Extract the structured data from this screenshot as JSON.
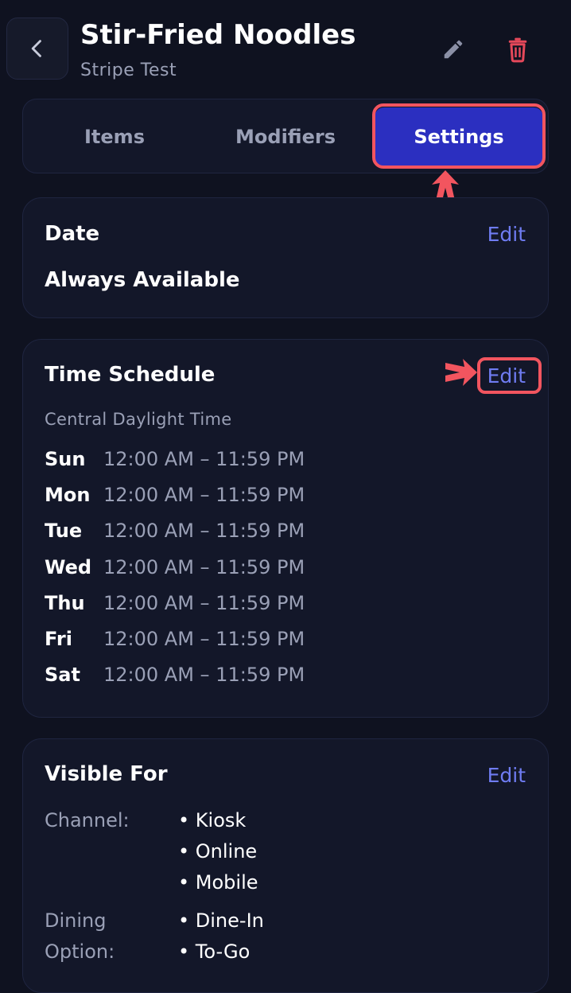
{
  "header": {
    "title": "Stir-Fried Noodles",
    "subtitle": "Stripe Test"
  },
  "tabs": [
    {
      "label": "Items",
      "active": false
    },
    {
      "label": "Modifiers",
      "active": false
    },
    {
      "label": "Settings",
      "active": true
    }
  ],
  "date_card": {
    "title": "Date",
    "edit_label": "Edit",
    "value": "Always Available"
  },
  "time_card": {
    "title": "Time Schedule",
    "edit_label": "Edit",
    "timezone": "Central Daylight Time",
    "schedule": [
      {
        "day": "Sun",
        "hours": "12:00 AM – 11:59 PM"
      },
      {
        "day": "Mon",
        "hours": "12:00 AM – 11:59 PM"
      },
      {
        "day": "Tue",
        "hours": "12:00 AM – 11:59 PM"
      },
      {
        "day": "Wed",
        "hours": "12:00 AM – 11:59 PM"
      },
      {
        "day": "Thu",
        "hours": "12:00 AM – 11:59 PM"
      },
      {
        "day": "Fri",
        "hours": "12:00 AM – 11:59 PM"
      },
      {
        "day": "Sat",
        "hours": "12:00 AM – 11:59 PM"
      }
    ]
  },
  "visible_card": {
    "title": "Visible For",
    "edit_label": "Edit",
    "channel_label": "Channel:",
    "channels": [
      "• Kiosk",
      "• Online",
      "• Mobile"
    ],
    "dining_label_line1": "Dining",
    "dining_label_line2": "Option:",
    "dining_options": [
      "• Dine-In",
      "• To-Go"
    ]
  },
  "colors": {
    "background": "#0f1220",
    "card": "#131729",
    "accent": "#6f7cf2",
    "active_tab": "#2b2fc0",
    "delete": "#e5485a",
    "annotation": "#f2555f"
  }
}
